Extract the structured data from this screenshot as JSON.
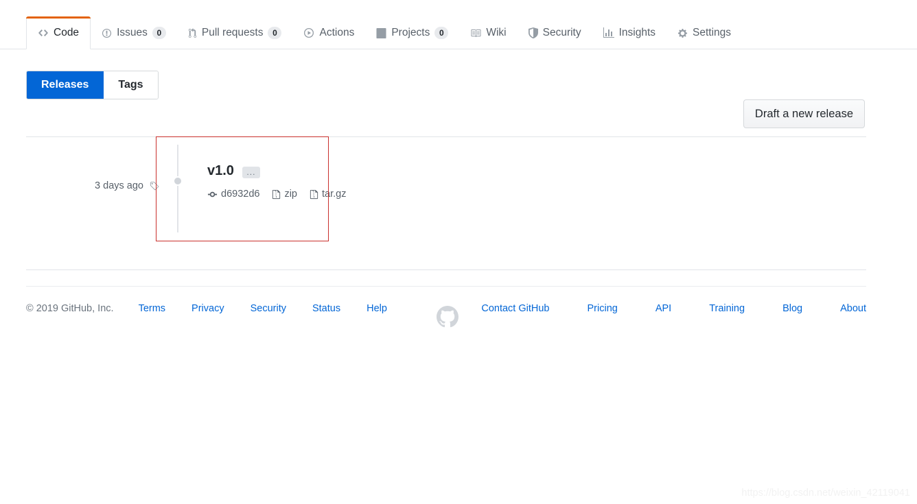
{
  "colors": {
    "accent_blue": "#0366d6",
    "active_tab_orange": "#e36209",
    "annotation_red": "#c9302c",
    "text_primary": "#24292e",
    "text_muted": "#586069",
    "border": "#e1e4e8"
  },
  "repo_nav": {
    "tabs": [
      {
        "label": "Code",
        "icon": "code-icon",
        "count": null,
        "selected": true
      },
      {
        "label": "Issues",
        "icon": "issue-opened-icon",
        "count": "0",
        "selected": false
      },
      {
        "label": "Pull requests",
        "icon": "git-pull-request-icon",
        "count": "0",
        "selected": false
      },
      {
        "label": "Actions",
        "icon": "play-icon",
        "count": null,
        "selected": false
      },
      {
        "label": "Projects",
        "icon": "project-icon",
        "count": "0",
        "selected": false
      },
      {
        "label": "Wiki",
        "icon": "book-icon",
        "count": null,
        "selected": false
      },
      {
        "label": "Security",
        "icon": "shield-icon",
        "count": null,
        "selected": false
      },
      {
        "label": "Insights",
        "icon": "graph-icon",
        "count": null,
        "selected": false
      },
      {
        "label": "Settings",
        "icon": "gear-icon",
        "count": null,
        "selected": false
      }
    ]
  },
  "subnav": {
    "items": [
      {
        "label": "Releases",
        "selected": true
      },
      {
        "label": "Tags",
        "selected": false
      }
    ]
  },
  "actions": {
    "draft_release_label": "Draft a new release"
  },
  "releases": [
    {
      "relative_time": "3 days ago",
      "time_icon": "tag-icon",
      "version": "v1.0",
      "ellipsis_label": "...",
      "commit_icon": "git-commit-icon",
      "commit_sha": "d6932d6",
      "downloads": [
        {
          "label": "zip",
          "icon": "file-zip-icon"
        },
        {
          "label": "tar.gz",
          "icon": "file-zip-icon"
        }
      ]
    }
  ],
  "footer": {
    "copyright": "© 2019 GitHub, Inc.",
    "left_links": [
      "Terms",
      "Privacy",
      "Security",
      "Status",
      "Help"
    ],
    "mark_icon": "github-mark-icon",
    "right_links": [
      "Contact GitHub",
      "Pricing",
      "API",
      "Training",
      "Blog",
      "About"
    ]
  },
  "watermark": "https://blog.csdn.net/weixin_42119041"
}
